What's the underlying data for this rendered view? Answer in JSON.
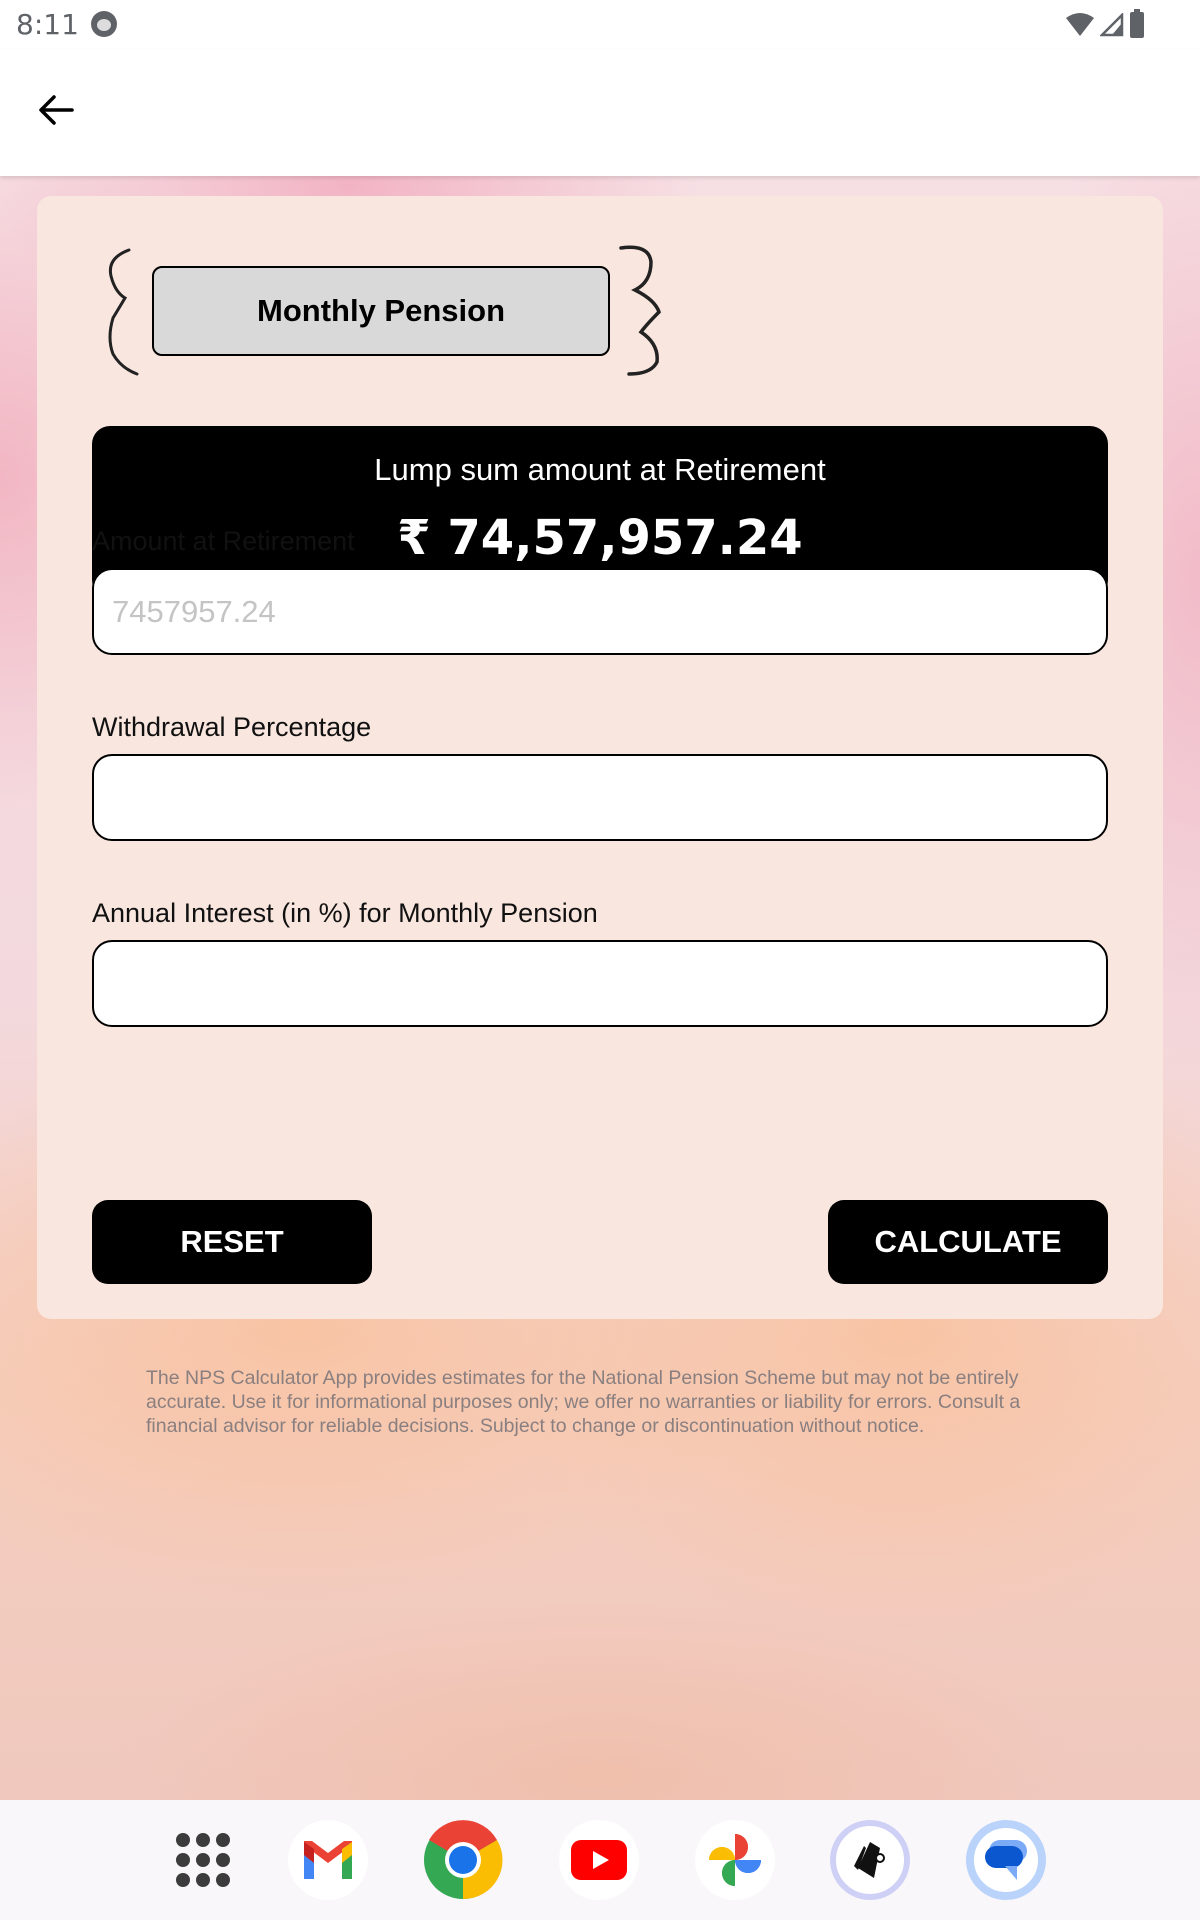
{
  "status_bar": {
    "time": "8:11",
    "icons": [
      "cat-notification-icon",
      "wifi-icon",
      "cellular-signal-icon",
      "battery-icon"
    ]
  },
  "app_bar": {
    "back_icon": "arrow-back-icon"
  },
  "card": {
    "mode_toggle_label": "Monthly Pension",
    "result": {
      "title": "Lump sum amount at Retirement",
      "value": "₹ 74,57,957.24"
    },
    "fields": [
      {
        "label": "Amount at Retirement",
        "value": "",
        "placeholder": "7457957.24"
      },
      {
        "label": "Withdrawal Percentage",
        "value": "",
        "placeholder": ""
      },
      {
        "label": "Annual Interest (in %) for Monthly Pension",
        "value": "",
        "placeholder": ""
      }
    ],
    "buttons": {
      "reset": "RESET",
      "calculate": "CALCULATE"
    }
  },
  "disclaimer": "The NPS Calculator App provides estimates for the National Pension Scheme but may not be entirely accurate. Use it for informational purposes only; we offer no warranties or liability for errors. Consult a financial advisor for reliable decisions. Subject to change or discontinuation without notice.",
  "dock": {
    "items": [
      "app-drawer",
      "Gmail",
      "Chrome",
      "YouTube",
      "Photos",
      "NPS Calculator",
      "Messages"
    ]
  },
  "colors": {
    "card_bg": "#f9e6df",
    "result_bg": "#000000",
    "toggle_bg": "#d9d9d9",
    "button_bg": "#000000"
  }
}
